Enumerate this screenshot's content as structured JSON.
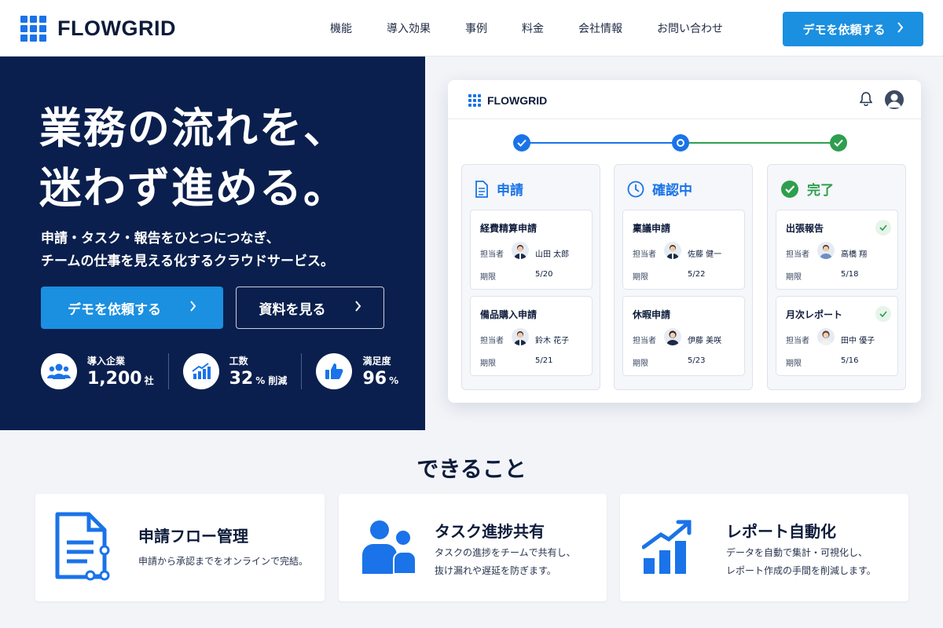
{
  "header": {
    "brand": "FLOWGRID",
    "nav": [
      "機能",
      "導入効果",
      "事例",
      "料金",
      "会社情報",
      "お問い合わせ"
    ],
    "cta_label": "デモを依頼する"
  },
  "hero": {
    "title_line1": "業務の流れを、",
    "title_line2": "迷わず進める。",
    "subtitle_line1": "申請・タスク・報告をひとつにつなぎ、",
    "subtitle_line2": "チームの仕事を見える化するクラウドサービス。",
    "primary_button": "デモを依頼する",
    "secondary_button": "資料を見る",
    "stats": [
      {
        "label": "導入企業",
        "value": "1,200",
        "unit": "社",
        "icon": "users-icon"
      },
      {
        "label": "工数",
        "value": "32",
        "unit": "% 削減",
        "icon": "chart-up-icon"
      },
      {
        "label": "満足度",
        "value": "96",
        "unit": "%",
        "icon": "thumbs-up-icon"
      }
    ]
  },
  "app": {
    "brand": "FLOWGRID",
    "columns": [
      {
        "title": "申請",
        "icon": "document-icon",
        "color": "#1a73e8",
        "tasks": [
          {
            "title": "経費精算申請",
            "assignee_label": "担当者",
            "assignee": "山田 太郎",
            "due_label": "期限",
            "due": "5/20"
          },
          {
            "title": "備品購入申請",
            "assignee_label": "担当者",
            "assignee": "鈴木 花子",
            "due_label": "期限",
            "due": "5/21"
          }
        ]
      },
      {
        "title": "確認中",
        "icon": "clock-icon",
        "color": "#1a73e8",
        "tasks": [
          {
            "title": "稟議申請",
            "assignee_label": "担当者",
            "assignee": "佐藤 健一",
            "due_label": "期限",
            "due": "5/22"
          },
          {
            "title": "休暇申請",
            "assignee_label": "担当者",
            "assignee": "伊藤 美咲",
            "due_label": "期限",
            "due": "5/23"
          }
        ]
      },
      {
        "title": "完了",
        "icon": "check-circle-icon",
        "color": "#2e9e4f",
        "tasks": [
          {
            "title": "出張報告",
            "assignee_label": "担当者",
            "assignee": "高橋 翔",
            "due_label": "期限",
            "due": "5/18"
          },
          {
            "title": "月次レポート",
            "assignee_label": "担当者",
            "assignee": "田中 優子",
            "due_label": "期限",
            "due": "5/16"
          }
        ]
      }
    ]
  },
  "features": {
    "section_title": "できること",
    "items": [
      {
        "title": "申請フロー管理",
        "desc_line1": "申請から承認までをオンラインで完結。",
        "desc_line2": ""
      },
      {
        "title": "タスク進捗共有",
        "desc_line1": "タスクの進捗をチームで共有し、",
        "desc_line2": "抜け漏れや遅延を防ぎます。"
      },
      {
        "title": "レポート自動化",
        "desc_line1": "データを自動で集計・可視化し、",
        "desc_line2": "レポート作成の手間を削減します。"
      }
    ]
  },
  "colors": {
    "navy": "#0a1f4d",
    "accent": "#1b8fe0",
    "blue": "#1a73e8",
    "green": "#2e9e4f"
  }
}
